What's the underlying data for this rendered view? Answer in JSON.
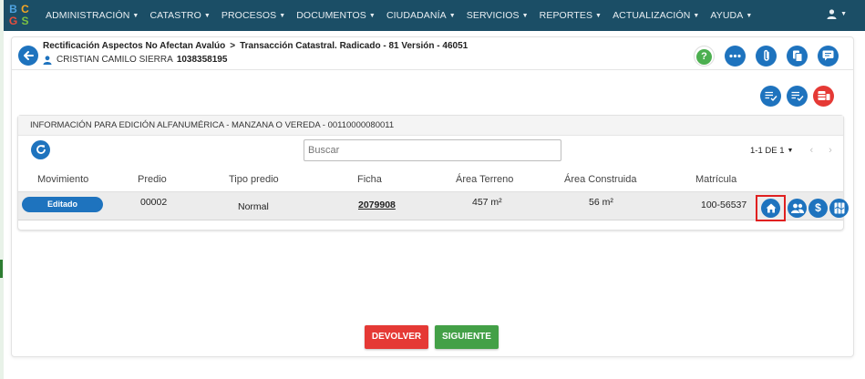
{
  "navbar": {
    "logo": [
      "B",
      "C",
      "G",
      "S"
    ],
    "menu": [
      {
        "label": "ADMINISTRACIÓN"
      },
      {
        "label": "CATASTRO"
      },
      {
        "label": "PROCESOS"
      },
      {
        "label": "DOCUMENTOS"
      },
      {
        "label": "CIUDADANÍA"
      },
      {
        "label": "SERVICIOS"
      },
      {
        "label": "REPORTES"
      },
      {
        "label": "ACTUALIZACIÓN"
      },
      {
        "label": "AYUDA"
      }
    ]
  },
  "header": {
    "breadcrumb_1": "Rectificación Aspectos No Afectan Avalúo",
    "breadcrumb_sep": ">",
    "breadcrumb_2": "Transacción Catastral. Radicado - 81 Versión - 46051",
    "user_name": "CRISTIAN CAMILO SIERRA",
    "user_doc": "1038358195"
  },
  "panel": {
    "title": "INFORMACIÓN PARA EDICIÓN ALFANUMÉRICA - MANZANA O VEREDA - 00110000080011",
    "search_placeholder": "Buscar",
    "pager_label": "1-1 DE 1",
    "columns": [
      "Movimiento",
      "Predio",
      "Tipo predio",
      "Ficha",
      "Área Terreno",
      "Área Construida",
      "Matrícula"
    ],
    "rows": [
      {
        "movimiento": "Editado",
        "predio": "00002",
        "tipo_predio": "Normal",
        "ficha": "2079908",
        "area_terreno": "457 m²",
        "area_construida": "56 m²",
        "matricula": "100-56537"
      }
    ]
  },
  "footer": {
    "devolver_label": "DEVOLVER",
    "siguiente_label": "SIGUIENTE"
  },
  "colors": {
    "navbar": "#1b4e66",
    "primary": "#1e73be",
    "danger": "#e53935",
    "success": "#43a047",
    "highlight": "#e02020"
  }
}
